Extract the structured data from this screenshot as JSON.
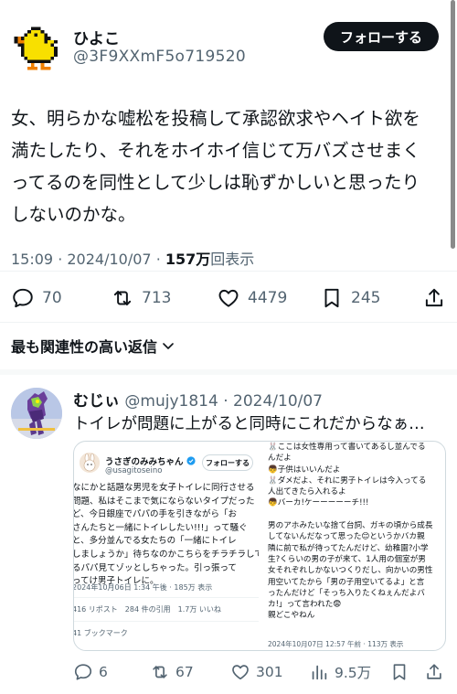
{
  "post": {
    "display_name": "ひよこ",
    "handle": "@3F9XXmF5o719520",
    "follow_label": "フォローする",
    "text_lines": [
      "女、明らかな嘘松を投稿して承認欲求やヘイト欲を",
      "満たしたり、それをホイホイ信じて万バズさせまく",
      "ってるのを同性として少しは恥ずかしいと思ったり",
      "しないのかな。"
    ],
    "time": "15:09",
    "date": "2024/10/07",
    "views_count": "157万",
    "views_label": "回表示",
    "actions": {
      "replies": "70",
      "reposts": "713",
      "likes": "4479",
      "bookmarks": "245"
    }
  },
  "replies_sort_label": "最も関連性の高い返信",
  "reply": {
    "display_name": "むじぃ",
    "handle": "@mujy1814",
    "date": "2024/10/07",
    "text": "トイレが問題に上がると同時にこれだからなぁ…",
    "actions": {
      "replies": "6",
      "reposts": "67",
      "likes": "301",
      "views": "9.5万"
    },
    "media_left": {
      "name": "うさぎのみみちゃん",
      "handle": "@usagitoseino",
      "follow_label": "フォローする",
      "lines": [
        "なにかと話題な男児を女子トイレに同行させる",
        "問題、私はそこまで気にならないタイプだった",
        "ど、今日銀座でパパの手を引きながら「お",
        "さんたちと一緒にトイレしたい!!!」って騒ぐ",
        "と、多分並んでる女たちの「一緒にトイレ",
        "しましょうか」待ちなのかこちらをチラチラして",
        "るパパ見てゾッとしちゃった。引っ張って",
        "ってけ男子トイレに。"
      ],
      "meta": "2024年10月06日 1:34 午後 · 185万 表示",
      "stats": "416 リポスト　284 件の引用　1.7万 いいね",
      "bookmarks": "41 ブックマーク"
    },
    "media_right": {
      "lines": [
        "🐰ここは女性専用って書いてあるし並んでる",
        "んだよ",
        "👦子供はいいんだよ",
        "🐰ダメだよ、それに男子トイレは今入ってる",
        "人出てきたら入れるよ",
        "👦バーカ!ケーーーーーチ!!!",
        "",
        "男のアホみたいな捨て台詞、ガキの頃から成長",
        "してないんだなって思った😊というかバカ親",
        "隣に前で私が待ってたんだけど、幼稚園?小学",
        "生?くらいの男の子が来て、1人用の個室が男",
        "女それぞれしかないつくりだし、向かいの男性",
        "用空いてたから「男の子用空いてるよ」と言",
        "ったんだけど「そっち入りたくねぇんだよバ",
        "カ!」って言われた😨",
        "親どこやねん"
      ],
      "meta": "2024年10月07日 12:57 午前 · 113万 表示"
    }
  },
  "colors": {
    "text": "#0f1419",
    "secondary": "#536471",
    "follow_bg": "#0f1419"
  }
}
